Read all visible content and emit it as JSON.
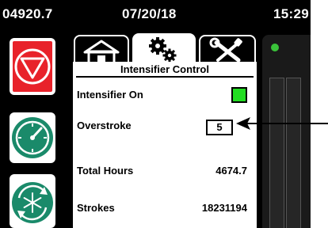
{
  "status_bar": {
    "counter": "04920.7",
    "date": "07/20/18",
    "time": "15:29"
  },
  "side_buttons": [
    {
      "name": "stop",
      "icon": "stop-icon",
      "color": "#e8222a"
    },
    {
      "name": "gauge",
      "icon": "gauge-icon",
      "color": "#1a8a6a"
    },
    {
      "name": "defrost",
      "icon": "defrost-icon",
      "color": "#1a8a6a"
    }
  ],
  "tabs": [
    {
      "name": "home",
      "icon": "home-icon",
      "active": false
    },
    {
      "name": "settings",
      "icon": "gears-icon",
      "active": true
    },
    {
      "name": "tools",
      "icon": "tools-icon",
      "active": false
    }
  ],
  "panel": {
    "title": "Intensifier Control",
    "intensifier_on_label": "Intensifier On",
    "intensifier_on_state": true,
    "intensifier_on_color": "#22dd22",
    "overstroke_label": "Overstroke",
    "overstroke_value": "5",
    "total_hours_label": "Total Hours",
    "total_hours_value": "4674.7",
    "strokes_label": "Strokes",
    "strokes_value": "18231194"
  },
  "status_indicator_color": "#3ac23a"
}
